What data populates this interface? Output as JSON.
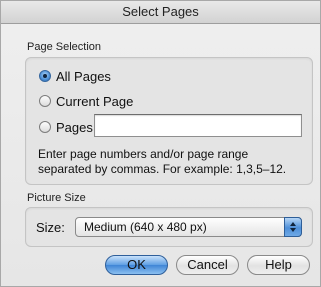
{
  "window": {
    "title": "Select Pages"
  },
  "page_selection": {
    "label": "Page Selection",
    "options": [
      {
        "label": "All Pages",
        "checked": true
      },
      {
        "label": "Current Page",
        "checked": false
      },
      {
        "label": "Pages",
        "checked": false
      }
    ],
    "pages_value": "",
    "help_line1": "Enter page numbers and/or page range",
    "help_line2": "separated by commas.  For example: 1,3,5–12."
  },
  "picture_size": {
    "label": "Picture Size",
    "size_label": "Size:",
    "selected": "Medium (640 x 480 px)"
  },
  "buttons": {
    "ok": "OK",
    "cancel": "Cancel",
    "help": "Help"
  }
}
